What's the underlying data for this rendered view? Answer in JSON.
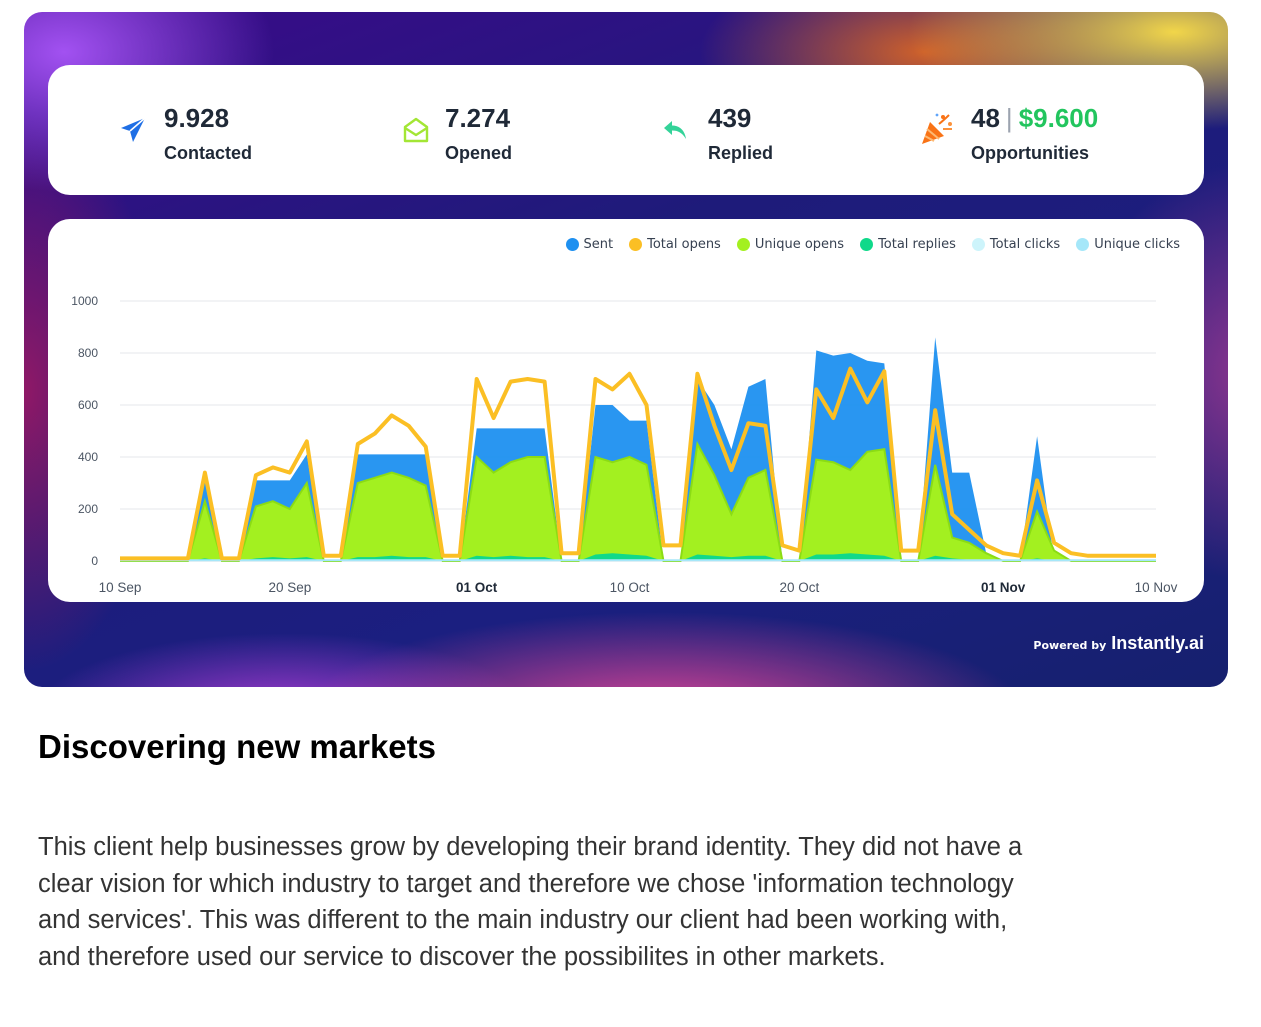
{
  "stats": {
    "contacted": {
      "value": "9.928",
      "label": "Contacted",
      "icon": "paper-plane-icon"
    },
    "opened": {
      "value": "7.274",
      "label": "Opened",
      "icon": "open-envelope-icon"
    },
    "replied": {
      "value": "439",
      "label": "Replied",
      "icon": "reply-arrow-icon"
    },
    "opportunities": {
      "count": "48",
      "separator": "|",
      "amount": "$9.600",
      "label": "Opportunities",
      "icon": "party-popper-icon"
    }
  },
  "colors": {
    "sent": "#1e90f0",
    "total_opens": "#fbbf24",
    "unique_opens": "#a3f020",
    "total_replies": "#10d98a",
    "total_clicks": "#cdf4fb",
    "unique_clicks": "#a5e7f9"
  },
  "chart_data": {
    "type": "area",
    "ylim": [
      0,
      1000
    ],
    "yticks": [
      "0",
      "200",
      "400",
      "600",
      "800",
      "1000"
    ],
    "x_start": "10 Sep",
    "x_end": "10 Nov",
    "xticks": [
      {
        "label": "10 Sep",
        "day": 0,
        "bold": false
      },
      {
        "label": "20 Sep",
        "day": 10,
        "bold": false
      },
      {
        "label": "01 Oct",
        "day": 21,
        "bold": true
      },
      {
        "label": "10 Oct",
        "day": 30,
        "bold": false
      },
      {
        "label": "20 Oct",
        "day": 40,
        "bold": false
      },
      {
        "label": "01 Nov",
        "day": 52,
        "bold": true
      },
      {
        "label": "10 Nov",
        "day": 61,
        "bold": false
      }
    ],
    "legend": [
      {
        "name": "Sent",
        "color": "#1e90f0"
      },
      {
        "name": "Total opens",
        "color": "#fbbf24"
      },
      {
        "name": "Unique opens",
        "color": "#a3f020"
      },
      {
        "name": "Total replies",
        "color": "#10d98a"
      },
      {
        "name": "Total clicks",
        "color": "#cdf4fb"
      },
      {
        "name": "Unique clicks",
        "color": "#a5e7f9"
      }
    ],
    "days": [
      "2023-09-10",
      "2023-09-11",
      "2023-09-12",
      "2023-09-13",
      "2023-09-14",
      "2023-09-15",
      "2023-09-16",
      "2023-09-17",
      "2023-09-18",
      "2023-09-19",
      "2023-09-20",
      "2023-09-21",
      "2023-09-22",
      "2023-09-23",
      "2023-09-24",
      "2023-09-25",
      "2023-09-26",
      "2023-09-27",
      "2023-09-28",
      "2023-09-29",
      "2023-09-30",
      "2023-10-01",
      "2023-10-02",
      "2023-10-03",
      "2023-10-04",
      "2023-10-05",
      "2023-10-06",
      "2023-10-07",
      "2023-10-08",
      "2023-10-09",
      "2023-10-10",
      "2023-10-11",
      "2023-10-12",
      "2023-10-13",
      "2023-10-14",
      "2023-10-15",
      "2023-10-16",
      "2023-10-17",
      "2023-10-18",
      "2023-10-19",
      "2023-10-20",
      "2023-10-21",
      "2023-10-22",
      "2023-10-23",
      "2023-10-24",
      "2023-10-25",
      "2023-10-26",
      "2023-10-27",
      "2023-10-28",
      "2023-10-29",
      "2023-10-30",
      "2023-10-31",
      "2023-11-01",
      "2023-11-02",
      "2023-11-03",
      "2023-11-04",
      "2023-11-05",
      "2023-11-06",
      "2023-11-07",
      "2023-11-08",
      "2023-11-09",
      "2023-11-10"
    ],
    "series": [
      {
        "name": "Sent",
        "values": [
          0,
          0,
          0,
          0,
          0,
          310,
          0,
          0,
          310,
          310,
          310,
          410,
          0,
          0,
          410,
          410,
          410,
          410,
          410,
          0,
          0,
          510,
          510,
          510,
          510,
          510,
          0,
          0,
          600,
          600,
          540,
          540,
          0,
          0,
          700,
          600,
          430,
          670,
          700,
          0,
          0,
          810,
          790,
          800,
          770,
          760,
          0,
          0,
          860,
          340,
          340,
          30,
          0,
          0,
          480,
          0,
          0,
          0,
          0,
          0,
          0,
          0
        ]
      },
      {
        "name": "Total opens",
        "values": [
          10,
          10,
          10,
          10,
          10,
          340,
          10,
          10,
          330,
          360,
          340,
          460,
          20,
          20,
          450,
          490,
          560,
          520,
          440,
          20,
          20,
          700,
          550,
          690,
          700,
          690,
          30,
          30,
          700,
          660,
          720,
          600,
          60,
          60,
          720,
          520,
          350,
          530,
          520,
          60,
          40,
          660,
          550,
          740,
          610,
          730,
          40,
          40,
          580,
          180,
          120,
          60,
          30,
          20,
          310,
          70,
          30,
          20,
          20,
          20,
          20,
          20
        ]
      },
      {
        "name": "Unique opens",
        "values": [
          0,
          0,
          0,
          0,
          0,
          230,
          0,
          0,
          210,
          230,
          200,
          300,
          0,
          0,
          300,
          320,
          340,
          320,
          290,
          0,
          0,
          400,
          340,
          380,
          400,
          400,
          0,
          0,
          400,
          380,
          400,
          370,
          0,
          0,
          450,
          330,
          180,
          320,
          350,
          0,
          0,
          390,
          380,
          350,
          420,
          430,
          0,
          0,
          370,
          90,
          70,
          30,
          0,
          0,
          190,
          40,
          0,
          0,
          0,
          0,
          0,
          0
        ]
      },
      {
        "name": "Total replies",
        "values": [
          0,
          0,
          0,
          0,
          0,
          10,
          0,
          0,
          10,
          15,
          10,
          15,
          0,
          0,
          15,
          15,
          20,
          15,
          15,
          0,
          0,
          20,
          15,
          20,
          15,
          15,
          0,
          0,
          25,
          30,
          25,
          20,
          0,
          0,
          25,
          20,
          15,
          20,
          20,
          0,
          0,
          25,
          25,
          30,
          25,
          20,
          0,
          0,
          20,
          10,
          5,
          5,
          0,
          0,
          10,
          0,
          0,
          0,
          0,
          0,
          0,
          0
        ]
      },
      {
        "name": "Total clicks",
        "values": [
          0,
          0,
          0,
          0,
          0,
          0,
          0,
          0,
          0,
          0,
          0,
          0,
          0,
          0,
          0,
          0,
          0,
          0,
          0,
          0,
          0,
          0,
          0,
          0,
          0,
          0,
          0,
          0,
          0,
          0,
          0,
          0,
          0,
          0,
          0,
          0,
          0,
          0,
          0,
          0,
          0,
          0,
          0,
          0,
          0,
          0,
          0,
          0,
          0,
          0,
          0,
          0,
          0,
          0,
          0,
          0,
          0,
          0,
          0,
          0,
          0,
          0
        ]
      },
      {
        "name": "Unique clicks",
        "values": [
          0,
          0,
          0,
          0,
          0,
          0,
          0,
          0,
          0,
          0,
          0,
          0,
          0,
          0,
          0,
          0,
          0,
          0,
          0,
          0,
          0,
          0,
          0,
          0,
          0,
          0,
          0,
          0,
          0,
          0,
          0,
          0,
          0,
          0,
          0,
          0,
          0,
          0,
          0,
          0,
          0,
          0,
          0,
          0,
          0,
          0,
          0,
          0,
          0,
          0,
          0,
          0,
          0,
          0,
          0,
          0,
          0,
          0,
          0,
          0,
          0,
          0
        ]
      }
    ]
  },
  "powered_by": {
    "prefix": "Powered by",
    "brand": "Instantly.ai"
  },
  "section": {
    "title": "Discovering new markets",
    "body": "This client help businesses grow by developing their brand identity. They did not have a clear vision for which industry to target and therefore we chose 'information technology and services'. This was different to the main industry our client had been working with, and therefore used our service to discover the possibilites in other markets."
  }
}
